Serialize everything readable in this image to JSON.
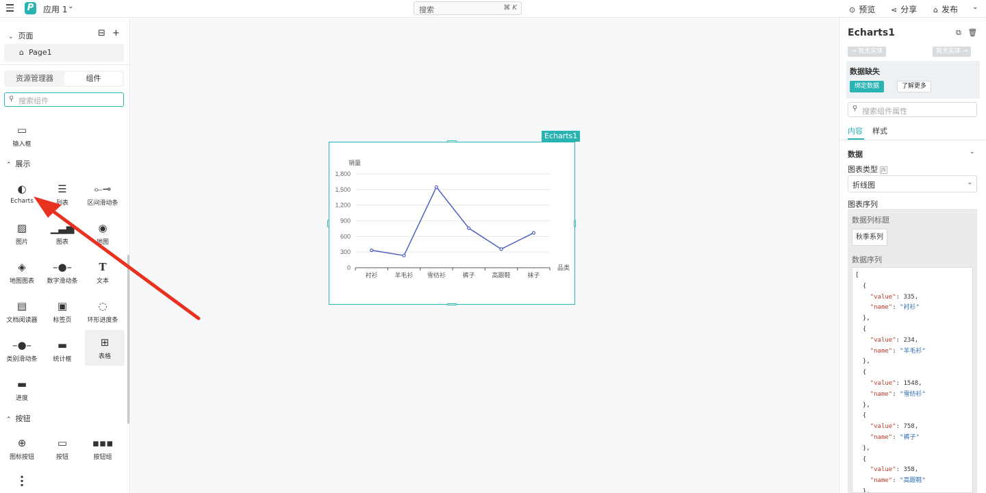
{
  "topbar": {
    "app_name": "应用 1",
    "search_placeholder": "搜索",
    "search_shortcut": "⌘ K",
    "preview_label": "预览",
    "share_label": "分享",
    "publish_label": "发布"
  },
  "left": {
    "pages_title": "页面",
    "pages": [
      "Page1"
    ],
    "tabs": [
      "资源管理器",
      "组件"
    ],
    "search_placeholder": "搜索组件",
    "input_item": "输入框",
    "section_display": "展示",
    "components": [
      {
        "label": "Echarts",
        "icon": "echarts-icon"
      },
      {
        "label": "列表",
        "icon": "list-icon"
      },
      {
        "label": "区间滑动条",
        "icon": "range-slider-icon"
      },
      {
        "label": "图片",
        "icon": "image-icon"
      },
      {
        "label": "图表",
        "icon": "chart-icon"
      },
      {
        "label": "地图",
        "icon": "map-pin-icon"
      },
      {
        "label": "地图图表",
        "icon": "map-chart-icon"
      },
      {
        "label": "数字滑动条",
        "icon": "number-slider-icon"
      },
      {
        "label": "文本",
        "icon": "text-icon"
      },
      {
        "label": "文档阅读器",
        "icon": "pdf-icon"
      },
      {
        "label": "标签页",
        "icon": "tabs-icon"
      },
      {
        "label": "环形进度条",
        "icon": "ring-progress-icon"
      },
      {
        "label": "类别滑动条",
        "icon": "category-slider-icon"
      },
      {
        "label": "统计框",
        "icon": "statistic-icon"
      },
      {
        "label": "表格",
        "icon": "table-icon"
      },
      {
        "label": "进度",
        "icon": "progress-icon"
      }
    ],
    "section_buttons": "按钮",
    "button_components": [
      {
        "label": "图标按钮",
        "icon": "icon-button-icon"
      },
      {
        "label": "按钮",
        "icon": "button-icon"
      },
      {
        "label": "按钮组",
        "icon": "button-group-icon"
      }
    ]
  },
  "canvas": {
    "chart_tag": "Echarts1"
  },
  "chart_data": {
    "type": "line",
    "categories": [
      "衬衫",
      "羊毛衫",
      "雪纺衫",
      "裤子",
      "高跟鞋",
      "袜子"
    ],
    "values": [
      335,
      234,
      1548,
      758,
      358,
      668
    ],
    "ylabel": "销量",
    "xlabel": "品类",
    "ylim": [
      0,
      1800
    ],
    "yticks": [
      "0",
      "300",
      "600",
      "900",
      "1,200",
      "1,500",
      "1,800"
    ],
    "line_color": "#4a5fc1"
  },
  "right": {
    "title": "Echarts1",
    "entity_prev": "→ 暂无实体",
    "entity_next": "暂无实体 →",
    "missing_title": "数据缺失",
    "bind_data": "绑定数据",
    "learn_more": "了解更多",
    "search_placeholder": "搜索组件属性",
    "tabs": [
      "内容",
      "样式"
    ],
    "section_data": "数据",
    "chart_type_label": "图表类型",
    "js_badge": "JS",
    "chart_type_value": "折线图",
    "series_label": "图表序列",
    "series_title_label": "数据列标题",
    "series_chip": "秋季系列",
    "series_data_label": "数据序列",
    "code_entries": [
      {
        "value": "335",
        "name": "衬衫"
      },
      {
        "value": "234",
        "name": "羊毛衫"
      },
      {
        "value": "1548",
        "name": "雪纺衫"
      },
      {
        "value": "758",
        "name": "裤子"
      },
      {
        "value": "358",
        "name": "高跟鞋"
      }
    ]
  },
  "colors": {
    "accent": "#2ab3b3",
    "arrow": "#e8321f"
  }
}
